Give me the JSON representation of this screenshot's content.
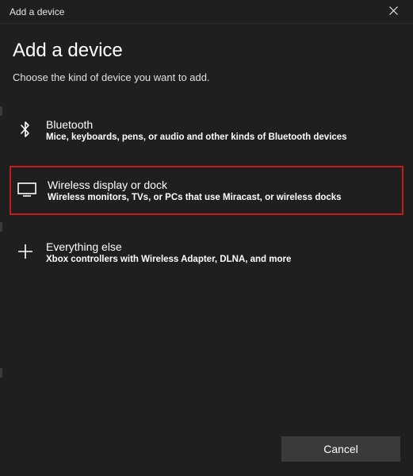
{
  "titlebar": {
    "title": "Add a device"
  },
  "heading": "Add a device",
  "subheading": "Choose the kind of device you want to add.",
  "options": [
    {
      "title": "Bluetooth",
      "desc": "Mice, keyboards, pens, or audio and other kinds of Bluetooth devices"
    },
    {
      "title": "Wireless display or dock",
      "desc": "Wireless monitors, TVs, or PCs that use Miracast, or wireless docks"
    },
    {
      "title": "Everything else",
      "desc": "Xbox controllers with Wireless Adapter, DLNA, and more"
    }
  ],
  "footer": {
    "cancel": "Cancel"
  }
}
